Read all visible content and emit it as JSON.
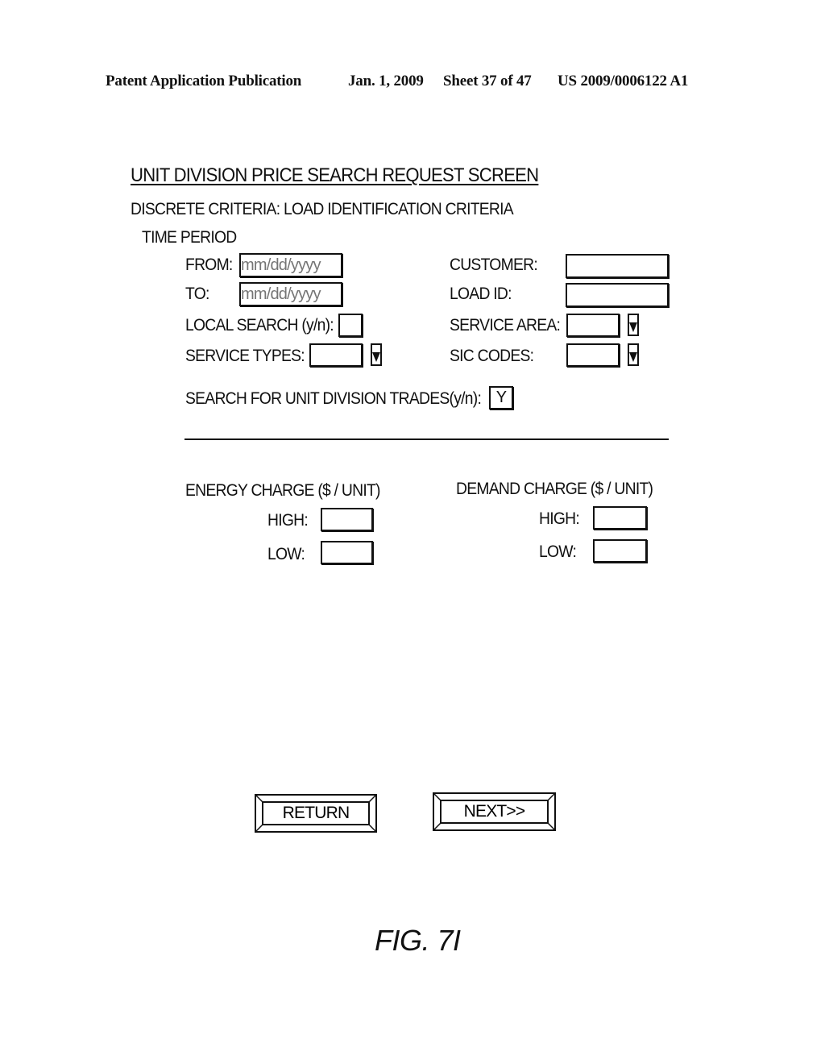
{
  "header": {
    "publication": "Patent Application Publication",
    "date": "Jan. 1, 2009",
    "sheet": "Sheet 37 of 47",
    "number": "US 2009/0006122 A1"
  },
  "screen": {
    "title": "UNIT DIVISION PRICE SEARCH REQUEST SCREEN",
    "subtitle": "DISCRETE CRITERIA: LOAD IDENTIFICATION CRITERIA",
    "time_period_label": "TIME PERIOD"
  },
  "fields": {
    "from": {
      "label": "FROM:",
      "placeholder": "mm/dd/yyyy",
      "value": ""
    },
    "to": {
      "label": "TO:",
      "placeholder": "mm/dd/yyyy",
      "value": ""
    },
    "local_search": {
      "label": "LOCAL SEARCH (y/n):",
      "value": ""
    },
    "service_types": {
      "label": "SERVICE TYPES:",
      "value": ""
    },
    "customer": {
      "label": "CUSTOMER:",
      "value": ""
    },
    "load_id": {
      "label": "LOAD ID:",
      "value": ""
    },
    "service_area": {
      "label": "SERVICE AREA:",
      "value": ""
    },
    "sic_codes": {
      "label": "SIC CODES:",
      "value": ""
    },
    "unit_division_trades": {
      "label": "SEARCH FOR UNIT DIVISION TRADES(y/n):",
      "value": "Y"
    }
  },
  "energy_charge": {
    "title": "ENERGY CHARGE ($ / UNIT)",
    "high_label": "HIGH:",
    "high_value": "",
    "low_label": "LOW:",
    "low_value": ""
  },
  "demand_charge": {
    "title": "DEMAND CHARGE ($ / UNIT)",
    "high_label": "HIGH:",
    "high_value": "",
    "low_label": "LOW:",
    "low_value": ""
  },
  "buttons": {
    "return_label": "RETURN",
    "next_label": "NEXT>>"
  },
  "figure_label": "FIG. 7I",
  "icons": {
    "dropdown": "dropdown-arrow-icon"
  }
}
